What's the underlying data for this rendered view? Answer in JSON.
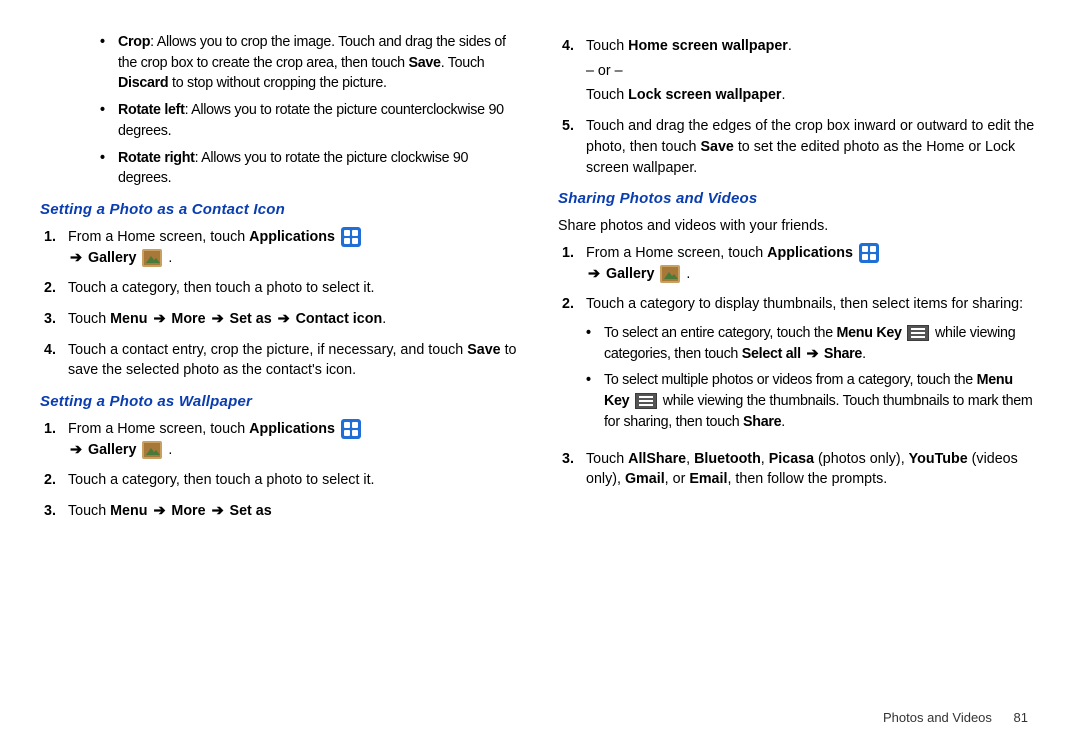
{
  "colors": {
    "heading": "#0a3db0"
  },
  "footer": {
    "section": "Photos and Videos",
    "page": "81"
  },
  "left": {
    "bullets_top": [
      {
        "term": "Crop",
        "desc_a": ": Allows you to crop the image. Touch and drag the sides of the crop box to create the crop area, then touch ",
        "b1": "Save",
        "desc_b": ". Touch ",
        "b2": "Discard",
        "desc_c": " to stop without cropping the picture."
      },
      {
        "term": "Rotate left",
        "desc_a": ": Allows you to rotate the picture counterclockwise 90 degrees."
      },
      {
        "term": "Rotate right",
        "desc_a": ": Allows you to rotate the picture clockwise 90 degrees."
      }
    ],
    "h1": "Setting a Photo as a Contact Icon",
    "s1": {
      "step1_a": "From a Home screen, touch ",
      "step1_b": "Applications",
      "step1_c": "Gallery",
      "step2": "Touch a category, then touch a photo to select it.",
      "step3_a": "Touch ",
      "step3_b": "Menu",
      "step3_c": "More",
      "step3_d": "Set as",
      "step3_e": "Contact icon",
      "step3_f": ".",
      "step4_a": "Touch a contact entry, crop the picture, if necessary, and touch ",
      "step4_b": "Save",
      "step4_c": " to save the selected photo as the contact's icon."
    },
    "h2": "Setting a Photo as Wallpaper",
    "s2": {
      "step1_a": "From a Home screen, touch ",
      "step1_b": "Applications",
      "step1_c": "Gallery",
      "step2": "Touch a category, then touch a photo to select it.",
      "step3_a": "Touch ",
      "step3_b": "Menu",
      "step3_c": "More",
      "step3_d": "Set as"
    }
  },
  "right": {
    "s2cont": {
      "step4_a": "Touch ",
      "step4_b": "Home screen wallpaper",
      "step4_c": ".",
      "or": "– or –",
      "step4_d": "Touch ",
      "step4_e": "Lock screen wallpaper",
      "step4_f": ".",
      "step5_a": "Touch and drag the edges of the crop box inward or outward to edit the photo, then touch ",
      "step5_b": "Save",
      "step5_c": " to set the edited photo as the Home or Lock screen wallpaper."
    },
    "h3": "Sharing Photos and Videos",
    "intro": "Share photos and videos with your friends.",
    "s3": {
      "step1_a": "From a Home screen, touch ",
      "step1_b": "Applications",
      "step1_c": "Gallery",
      "step2": "Touch a category to display thumbnails, then select items for sharing:",
      "b1_a": "To select an entire category, touch the ",
      "b1_b": "Menu Key",
      "b1_c": " while viewing categories, then touch ",
      "b1_d": "Select all",
      "b1_e": "Share",
      "b1_f": ".",
      "b2_a": "To select multiple photos or videos from a category, touch the ",
      "b2_b": "Menu Key",
      "b2_c": " while viewing the thumbnails. Touch thumbnails to mark them for sharing, then touch ",
      "b2_d": "Share",
      "b2_e": ".",
      "step3_a": "Touch ",
      "s3b1": "AllShare",
      "c1": ", ",
      "s3b2": "Bluetooth",
      "c2": ", ",
      "s3b3": "Picasa",
      "p1": " (photos only), ",
      "s3b4": "YouTube",
      "p2": " (videos only), ",
      "s3b5": "Gmail",
      "c3": ", or ",
      "s3b6": "Email",
      "tail": ", then follow the prompts."
    }
  }
}
